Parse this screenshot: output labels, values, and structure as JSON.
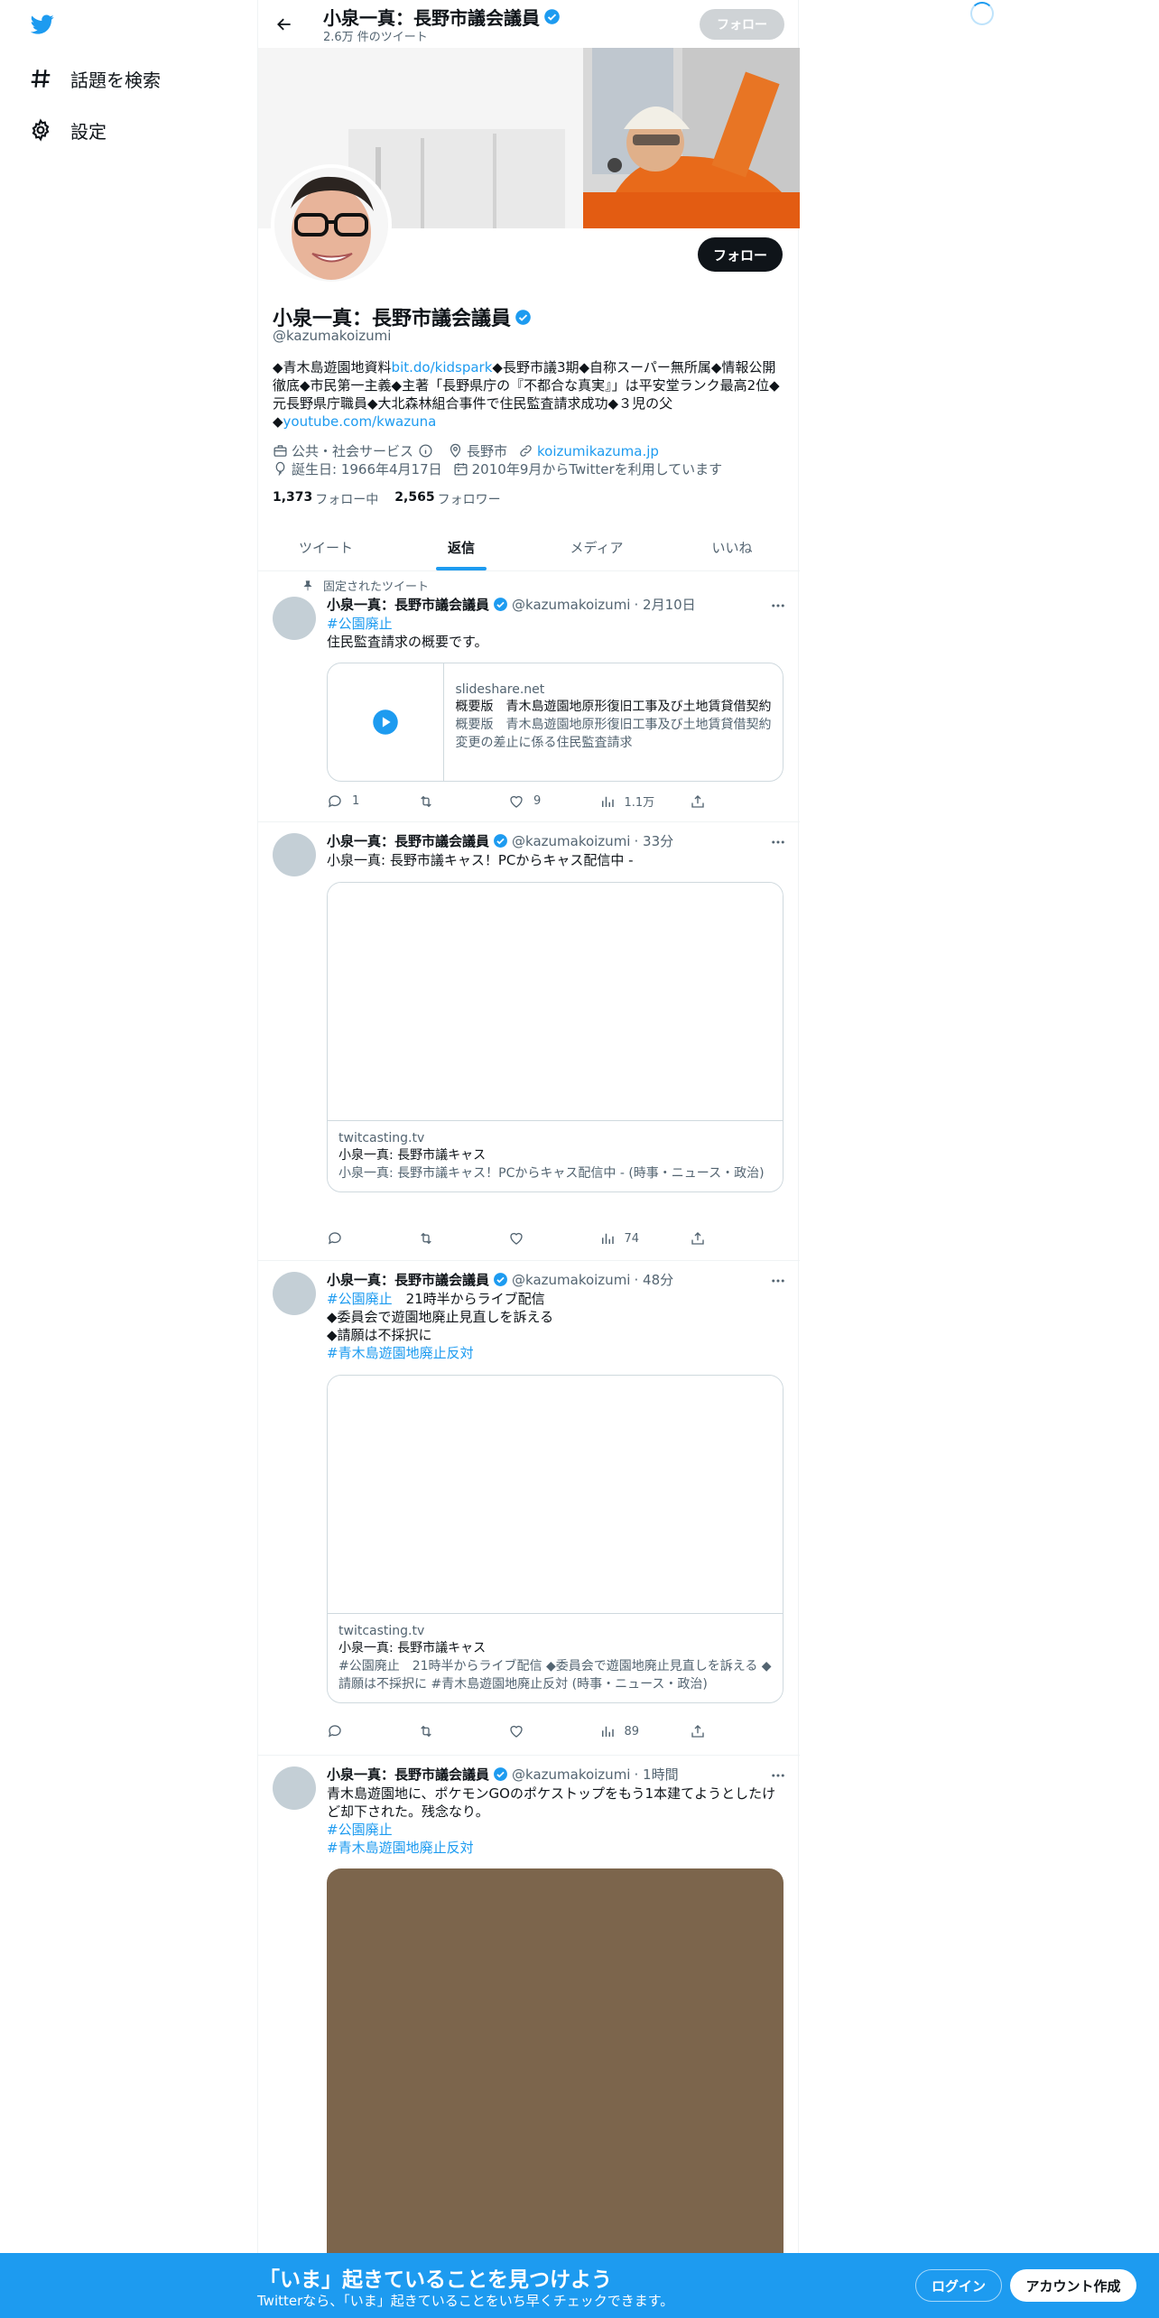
{
  "sidebar": {
    "explore_label": "話題を検索",
    "settings_label": "設定"
  },
  "header": {
    "name": "小泉一真：長野市議会議員",
    "tweet_count": "2.6万 件のツイート",
    "follow_label": "フォロー"
  },
  "profile": {
    "name": "小泉一真：長野市議会議員",
    "handle": "@kazumakoizumi",
    "follow_label": "フォロー",
    "bio_1": "◆青木島遊園地資料",
    "bio_link_1": "bit.do/kidspark",
    "bio_2": "◆長野市議3期◆自称スーパー無所属◆情報公開徹底◆市民第一主義◆主著「長野県庁の『不都合な真実』」は平安堂ランク最高2位◆元長野県庁職員◆大北森林組合事件で住民監査請求成功◆３児の父◆",
    "bio_link_2": "youtube.com/kwazuna",
    "category": "公共・社会サービス",
    "location": "長野市",
    "website": "koizumikazuma.jp",
    "birthday": "誕生日: 1966年4月17日",
    "joined": "2010年9月からTwitterを利用しています",
    "following_count": "1,373",
    "following_label": "フォロー中",
    "followers_count": "2,565",
    "followers_label": "フォロワー"
  },
  "tabs": [
    "ツイート",
    "返信",
    "メディア",
    "いいね"
  ],
  "pinned_label": "固定されたツイート",
  "tweets": [
    {
      "name": "小泉一真：長野市議会議員",
      "handle": "@kazumakoizumi",
      "time": "· 2月10日",
      "tag": "#公園廃止",
      "text": "住民監査請求の概要です。",
      "card": {
        "domain": "slideshare.net",
        "title": "概要版　青木島遊園地原形復旧工事及び土地賃貸借契約",
        "desc": "概要版　青木島遊園地原形復旧工事及び土地賃貸借契約変更の差止に係る住民監査請求"
      },
      "replies": "1",
      "retweets": "",
      "likes": "9",
      "views": "1.1万"
    },
    {
      "name": "小泉一真：長野市議会議員",
      "handle": "@kazumakoizumi",
      "time": "· 33分",
      "text": "小泉一真: 長野市議キャス！PCからキャス配信中 -",
      "card": {
        "domain": "twitcasting.tv",
        "title": "小泉一真: 長野市議キャス",
        "desc": "小泉一真: 長野市議キャス！PCからキャス配信中 - (時事・ニュース・政治)"
      },
      "replies": "",
      "retweets": "",
      "likes": "",
      "views": "74"
    },
    {
      "name": "小泉一真：長野市議会議員",
      "handle": "@kazumakoizumi",
      "time": "· 48分",
      "tag": "#公園廃止",
      "text_1": "　21時半からライブ配信",
      "text_2": "◆委員会で遊園地廃止見直しを訴える",
      "text_3": "◆請願は不採択に",
      "tag_2": "#青木島遊園地廃止反対",
      "card": {
        "domain": "twitcasting.tv",
        "title": "小泉一真: 長野市議キャス",
        "desc": "#公園廃止　21時半からライブ配信 ◆委員会で遊園地廃止見直しを訴える ◆請願は不採択に #青木島遊園地廃止反対 (時事・ニュース・政治)"
      },
      "replies": "",
      "retweets": "",
      "likes": "",
      "views": "89"
    },
    {
      "name": "小泉一真：長野市議会議員",
      "handle": "@kazumakoizumi",
      "time": "· 1時間",
      "text": "青木島遊園地に、ポケモンGOのポケストップをもう1本建てようとしたけど却下された。残念なり。",
      "tag": "#公園廃止",
      "tag_2": "#青木島遊園地廃止反対"
    }
  ],
  "bottom_bar": {
    "title": "「いま」起きていることを見つけよう",
    "subtitle": "Twitterなら、「いま」起きていることをいち早くチェックできます。",
    "login": "ログイン",
    "signup": "アカウント作成"
  },
  "colors": {
    "accent": "#1d9bf0",
    "text": "#0f1419",
    "muted": "#536471",
    "border": "#eff3f4"
  }
}
